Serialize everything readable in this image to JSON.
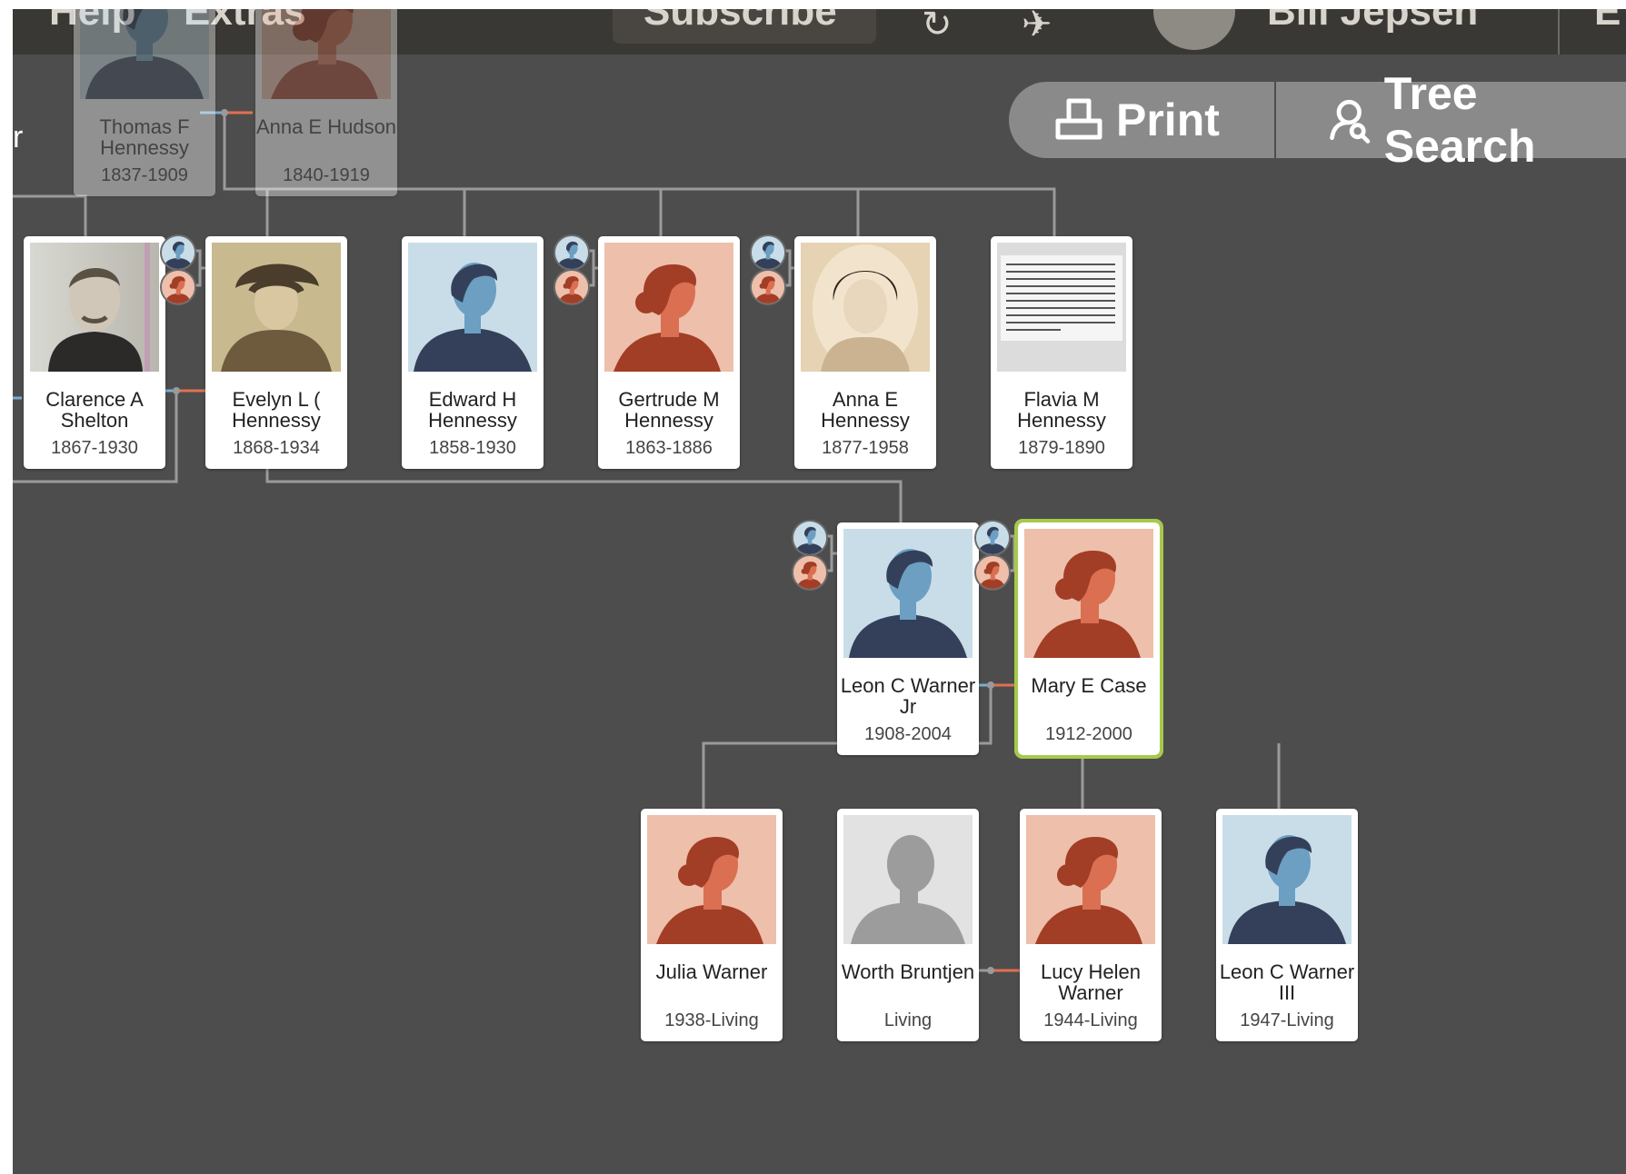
{
  "topbar": {
    "menu_help": "Help",
    "menu_extras": "Extras",
    "subscribe_label": "Subscribe",
    "user_name": "Bill Jepsen",
    "edge_label": "E"
  },
  "toolbar": {
    "print_label": "Print",
    "tree_search_label": "Tree Search"
  },
  "edge_clipped_text": "r",
  "people": [
    {
      "id": "thomas",
      "name": "Thomas F Hennessy",
      "years": "1837-1909",
      "gender": "male",
      "photo": "silhouette",
      "dim": true
    },
    {
      "id": "anna-h",
      "name": "Anna E Hudson",
      "years": "1840-1919",
      "gender": "female",
      "photo": "silhouette",
      "dim": true
    },
    {
      "id": "clarence",
      "name": "Clarence A Shelton",
      "years": "1867-1930",
      "gender": "male",
      "photo": "portrait"
    },
    {
      "id": "evelyn",
      "name": "Evelyn L ( Hennessy",
      "years": "1868-1934",
      "gender": "female",
      "photo": "portrait"
    },
    {
      "id": "edward",
      "name": "Edward H Hennessy",
      "years": "1858-1930",
      "gender": "male",
      "photo": "silhouette"
    },
    {
      "id": "gertrude",
      "name": "Gertrude M Hennessy",
      "years": "1863-1886",
      "gender": "female",
      "photo": "silhouette"
    },
    {
      "id": "anna",
      "name": "Anna E Hennessy",
      "years": "1877-1958",
      "gender": "female",
      "photo": "portrait"
    },
    {
      "id": "flavia",
      "name": "Flavia M Hennessy",
      "years": "1879-1890",
      "gender": "female",
      "photo": "clipping"
    },
    {
      "id": "leon",
      "name": "Leon C Warner Jr",
      "years": "1908-2004",
      "gender": "male",
      "photo": "silhouette"
    },
    {
      "id": "mary",
      "name": "Mary E Case",
      "years": "1912-2000",
      "gender": "female",
      "photo": "silhouette",
      "selected": true
    },
    {
      "id": "julia",
      "name": "Julia Warner",
      "years": "1938-Living",
      "gender": "female",
      "photo": "silhouette"
    },
    {
      "id": "worth",
      "name": "Worth Bruntjen",
      "years": "Living",
      "gender": "unknown",
      "photo": "silhouette"
    },
    {
      "id": "lucy",
      "name": "Lucy Helen Warner",
      "years": "1944-Living",
      "gender": "female",
      "photo": "silhouette"
    },
    {
      "id": "leon3",
      "name": "Leon C Warner III",
      "years": "1947-Living",
      "gender": "male",
      "photo": "silhouette"
    }
  ],
  "colors": {
    "canvas_bg": "#4d4d4d",
    "topbar_bg": "#3a3834",
    "line": "#9a9a9a",
    "male_line": "#79aed0",
    "female_line": "#e0714f",
    "selected_border": "#a7c94a",
    "male_bg": "#c9dde9",
    "male_fg": "#34405a",
    "male_face": "#6c9fc2",
    "female_bg": "#eebfab",
    "female_fg": "#a23d26",
    "female_face": "#da6f52",
    "unknown_bg": "#e2e2e2",
    "unknown_fg": "#9c9c9c"
  }
}
